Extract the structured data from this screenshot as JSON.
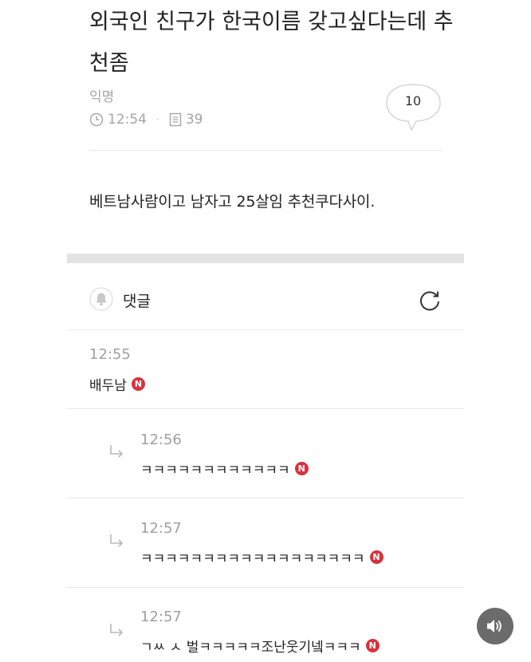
{
  "post": {
    "title": "외국인 친구가 한국이름 갖고싶다는데 추천좀",
    "author": "익명",
    "time": "12:54",
    "views": "39",
    "comment_count": "10",
    "body": "베트남사람이고 남자고 25살임 추천쿠다사이."
  },
  "comments_section": {
    "label": "댓글"
  },
  "comments": [
    {
      "time": "12:55",
      "text": "배두남",
      "badge": "N"
    },
    {
      "time": "12:56",
      "text": "ㅋㅋㅋㅋㅋㅋㅋㅋㅋㅋㅋㅋ",
      "badge": "N",
      "reply": true
    },
    {
      "time": "12:57",
      "text": "ㅋㅋㅋㅋㅋㅋㅋㅋㅋㅋㅋㅋㅋㅋㅋㅋㅋㅋ",
      "badge": "N",
      "reply": true
    },
    {
      "time": "12:57",
      "text": "ㄱㅆ ㅅ 벌ㅋㅋㅋㅋㅋ조난웃기넼ㅋㅋㅋ",
      "badge": "N",
      "reply": true
    }
  ],
  "colors": {
    "badge": "#d8323d",
    "meta_gray": "#a5a5a5",
    "audio_button": "#6b6b6b"
  }
}
